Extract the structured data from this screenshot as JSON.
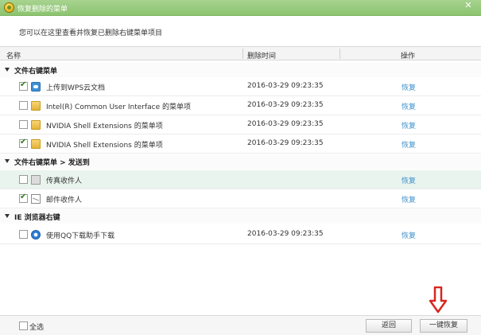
{
  "window": {
    "title": "恢复删除的菜单",
    "close": "✕"
  },
  "description": "您可以在这里查看并恢复已删除右键菜单项目",
  "columns": {
    "name": "名称",
    "time": "删除时间",
    "action": "操作"
  },
  "groups": [
    {
      "label": "文件右键菜单",
      "items": [
        {
          "name": "上传到WPS云文档",
          "time": "2016-03-29 09:23:35",
          "action": "恢复",
          "checked": true,
          "icon": "cloud-icon"
        },
        {
          "name": "Intel(R) Common User Interface 的菜单项",
          "time": "2016-03-29 09:23:35",
          "action": "恢复",
          "checked": false,
          "icon": "folder-icon"
        },
        {
          "name": "NVIDIA Shell Extensions 的菜单项",
          "time": "2016-03-29 09:23:35",
          "action": "恢复",
          "checked": false,
          "icon": "folder-icon"
        },
        {
          "name": "NVIDIA Shell Extensions 的菜单项",
          "time": "2016-03-29 09:23:35",
          "action": "恢复",
          "checked": true,
          "icon": "folder-icon"
        }
      ]
    },
    {
      "label": "文件右键菜单 > 发送到",
      "items": [
        {
          "name": "传真收件人",
          "time": "",
          "action": "恢复",
          "checked": false,
          "icon": "fax-icon"
        },
        {
          "name": "邮件收件人",
          "time": "",
          "action": "恢复",
          "checked": true,
          "icon": "mail-icon"
        }
      ]
    },
    {
      "label": "IE 浏览器右键",
      "items": [
        {
          "name": "使用QQ下载助手下载",
          "time": "2016-03-29 09:23:35",
          "action": "恢复",
          "checked": false,
          "icon": "ie-icon"
        }
      ]
    }
  ],
  "footer": {
    "select_all": "全选",
    "back": "返回",
    "restore_all": "一键恢复"
  },
  "colors": {
    "titlebar": "#8cc36f",
    "link": "#3c8fc9",
    "highlight_row": "#e9f4ee",
    "arrow": "#d7261e"
  }
}
